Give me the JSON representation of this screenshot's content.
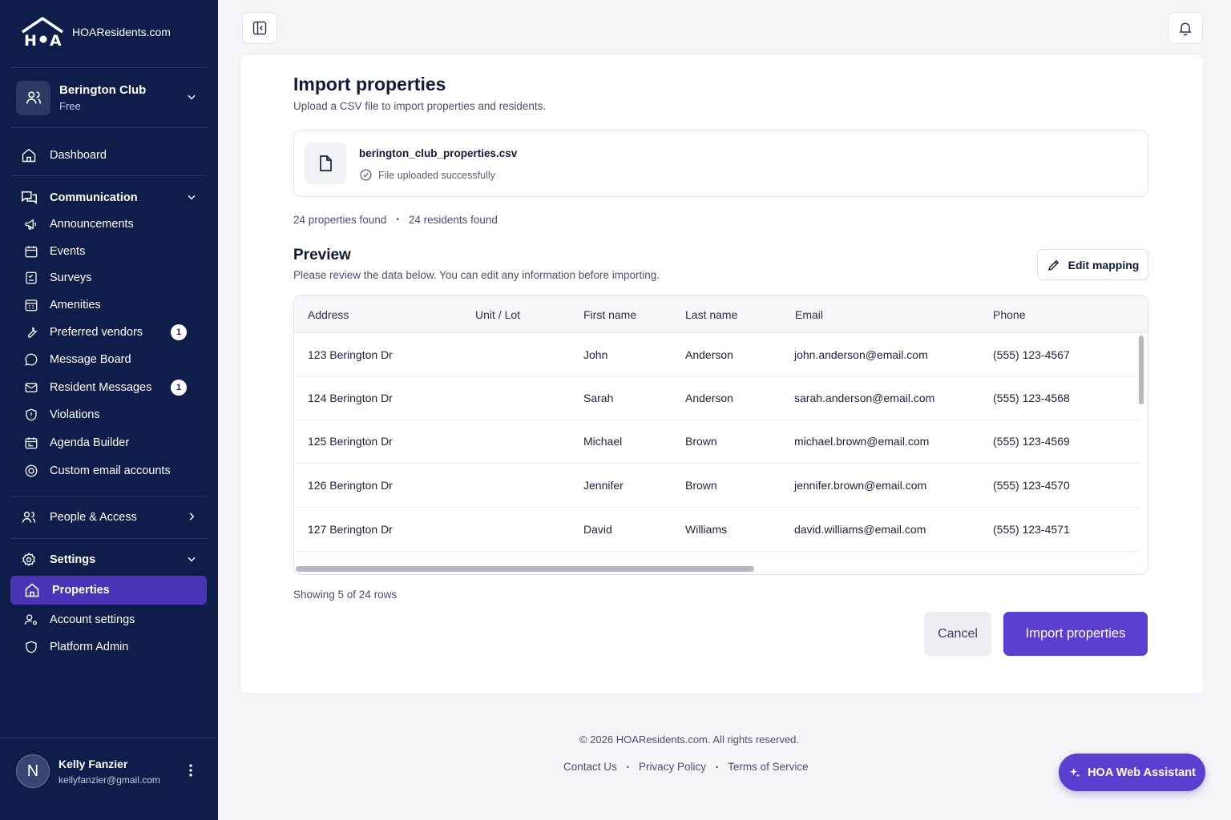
{
  "brand": {
    "name": "HOAResidents.com",
    "logo_letters": "HOA"
  },
  "club": {
    "name": "Berington Club",
    "plan": "Free"
  },
  "nav": {
    "dashboard": "Dashboard",
    "communication": "Communication",
    "announcements": "Announcements",
    "events": "Events",
    "surveys": "Surveys",
    "amenities": "Amenities",
    "preferred_vendors": "Preferred vendors",
    "preferred_vendors_badge": "1",
    "message_board": "Message Board",
    "resident_messages": "Resident Messages",
    "resident_messages_badge": "1",
    "violations": "Violations",
    "agenda_builder": "Agenda Builder",
    "custom_email": "Custom email accounts",
    "people_access": "People & Access",
    "settings": "Settings",
    "properties": "Properties",
    "account_settings": "Account settings",
    "platform_admin": "Platform Admin"
  },
  "user": {
    "initial": "N",
    "name": "Kelly Fanzier",
    "email": "kellyfanzier@gmail.com"
  },
  "page": {
    "title": "Import properties",
    "subtitle": "Upload a CSV file to import properties and residents.",
    "file_name": "berington_club_properties.csv",
    "file_status": "File uploaded successfully",
    "properties_found": "24 properties found",
    "residents_found": "24 residents found",
    "preview_title": "Preview",
    "preview_subtitle": "Please review the data below. You can edit any information before importing.",
    "edit_mapping": "Edit mapping",
    "showing": "Showing 5 of 24 rows",
    "cancel": "Cancel",
    "import": "Import properties"
  },
  "table": {
    "headers": [
      "Address",
      "Unit / Lot",
      "First name",
      "Last name",
      "Email",
      "Phone"
    ],
    "rows": [
      [
        "123 Berington Dr",
        "",
        "John",
        "Anderson",
        "john.anderson@email.com",
        "(555) 123-4567"
      ],
      [
        "124 Berington Dr",
        "",
        "Sarah",
        "Anderson",
        "sarah.anderson@email.com",
        "(555) 123-4568"
      ],
      [
        "125 Berington Dr",
        "",
        "Michael",
        "Brown",
        "michael.brown@email.com",
        "(555) 123-4569"
      ],
      [
        "126 Berington Dr",
        "",
        "Jennifer",
        "Brown",
        "jennifer.brown@email.com",
        "(555) 123-4570"
      ],
      [
        "127 Berington Dr",
        "",
        "David",
        "Williams",
        "david.williams@email.com",
        "(555) 123-4571"
      ]
    ]
  },
  "footer": {
    "copyright": "© 2026 HOAResidents.com. All rights reserved.",
    "contact": "Contact Us",
    "privacy": "Privacy Policy",
    "terms": "Terms of Service"
  },
  "assistant": {
    "label": "HOA Web Assistant"
  }
}
